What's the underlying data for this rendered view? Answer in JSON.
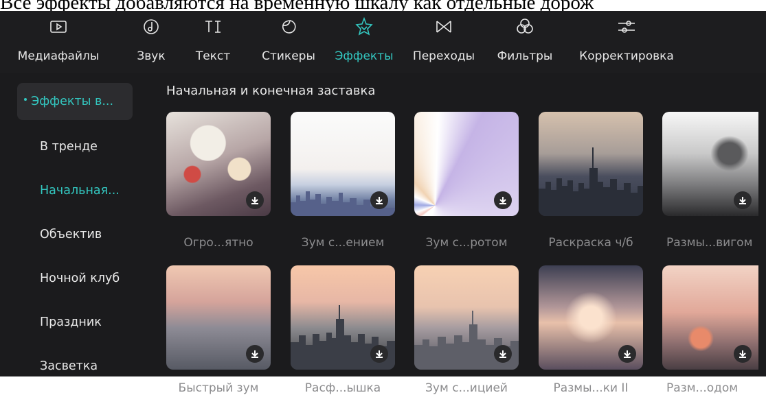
{
  "caption": "Все эффекты добавляются на временную шкалу как отдельные дорож",
  "toolbar": {
    "items": [
      {
        "label": "Медиафайлы",
        "icon": "media-icon"
      },
      {
        "label": "Звук",
        "icon": "music-note-icon"
      },
      {
        "label": "Текст",
        "icon": "text-icon"
      },
      {
        "label": "Стикеры",
        "icon": "sticker-icon"
      },
      {
        "label": "Эффекты",
        "icon": "effects-star-icon"
      },
      {
        "label": "Переходы",
        "icon": "transition-icon"
      },
      {
        "label": "Фильтры",
        "icon": "filter-icon"
      },
      {
        "label": "Корректировка",
        "icon": "adjust-icon"
      }
    ],
    "active": "Эффекты",
    "accent": "#33c7c0"
  },
  "sidebar": {
    "items": [
      {
        "label": "Эффекты в..."
      },
      {
        "label": "В тренде"
      },
      {
        "label": "Начальная..."
      },
      {
        "label": "Объектив"
      },
      {
        "label": "Ночной клуб"
      },
      {
        "label": "Праздник"
      },
      {
        "label": "Засветка"
      }
    ]
  },
  "main": {
    "section_title": "Начальная и конечная заставка",
    "cards": [
      {
        "label": "Огро...ятно"
      },
      {
        "label": "Зум с...ением"
      },
      {
        "label": "Зум с...ротом"
      },
      {
        "label": "Раскраска ч/б"
      },
      {
        "label": "Размы...вигом"
      },
      {
        "label": "Быстрый зум"
      },
      {
        "label": "Расф...ышка"
      },
      {
        "label": "Зум с...ицией"
      },
      {
        "label": "Размы...ки II"
      },
      {
        "label": "Разм...одом"
      }
    ]
  }
}
